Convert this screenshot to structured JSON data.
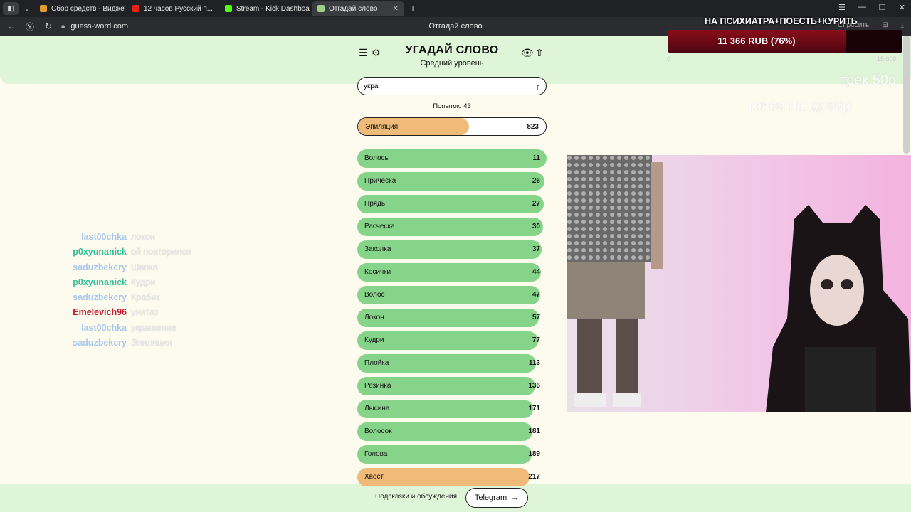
{
  "browser": {
    "tabs": [
      {
        "title": "Сбор средств - Виджеты",
        "color": "#e39a2e",
        "active": false
      },
      {
        "title": "12 часов Русский п...",
        "color": "#e62117",
        "active": false
      },
      {
        "title": "Stream - Kick Dashboard",
        "color": "#53fc18",
        "active": false
      },
      {
        "title": "Отгадай слово",
        "color": "#9bd08a",
        "active": true
      }
    ],
    "url": "guess-word.com",
    "page_title": "Отгадай слово",
    "right_label": "Спросить"
  },
  "game": {
    "title": "УГАДАЙ СЛОВО",
    "level": "Средний уровень",
    "input_value": "укра",
    "attempts": "Попыток: 43",
    "last_guess": {
      "word": "Эпиляция",
      "rank": "823",
      "fill": 0.59,
      "color": "#f0bb79"
    },
    "guesses": [
      {
        "word": "Волосы",
        "rank": "11",
        "fill": 1.0,
        "color": "#86d48a"
      },
      {
        "word": "Прическа",
        "rank": "26",
        "fill": 0.99,
        "color": "#86d48a"
      },
      {
        "word": "Прядь",
        "rank": "27",
        "fill": 0.985,
        "color": "#86d48a"
      },
      {
        "word": "Расческа",
        "rank": "30",
        "fill": 0.98,
        "color": "#86d48a"
      },
      {
        "word": "Заколка",
        "rank": "37",
        "fill": 0.975,
        "color": "#86d48a"
      },
      {
        "word": "Косички",
        "rank": "44",
        "fill": 0.97,
        "color": "#86d48a"
      },
      {
        "word": "Волос",
        "rank": "47",
        "fill": 0.965,
        "color": "#86d48a"
      },
      {
        "word": "Локон",
        "rank": "57",
        "fill": 0.96,
        "color": "#86d48a"
      },
      {
        "word": "Кудри",
        "rank": "77",
        "fill": 0.955,
        "color": "#86d48a"
      },
      {
        "word": "Плойка",
        "rank": "113",
        "fill": 0.945,
        "color": "#86d48a"
      },
      {
        "word": "Резинка",
        "rank": "136",
        "fill": 0.94,
        "color": "#86d48a"
      },
      {
        "word": "Лысина",
        "rank": "171",
        "fill": 0.93,
        "color": "#86d48a"
      },
      {
        "word": "Волосок",
        "rank": "181",
        "fill": 0.925,
        "color": "#86d48a"
      },
      {
        "word": "Голова",
        "rank": "189",
        "fill": 0.92,
        "color": "#86d48a"
      },
      {
        "word": "Хвост",
        "rank": "217",
        "fill": 0.91,
        "color": "#f0bb79"
      }
    ],
    "footer_text": "Подсказки и обсуждения",
    "telegram_label": "Telegram"
  },
  "stream": {
    "donation": {
      "title": "НА ПСИХИАТРА+ПОЕСТЬ+КУРИТЬ",
      "amount": "11 366 RUB (76%)",
      "progress": 0.76,
      "min": "0",
      "max": "15 000"
    },
    "ghost_text": [
      "трек 50р",
      "голос на кд 50р"
    ],
    "chat": [
      {
        "user": "last00chka",
        "msg": "локон",
        "color": "#a9c8ee"
      },
      {
        "user": "p0xyunanick",
        "msg": "ой повторился",
        "color": "#2fbf9a"
      },
      {
        "user": "saduzbekcry",
        "msg": "Шапка",
        "color": "#a9c8ee"
      },
      {
        "user": "p0xyunanick",
        "msg": "Кудри",
        "color": "#2fbf9a"
      },
      {
        "user": "saduzbekcry",
        "msg": "Крабик",
        "color": "#a9c8ee"
      },
      {
        "user": "Emelevich96",
        "msg": "унитаз",
        "color": "#c4182e"
      },
      {
        "user": "last00chka",
        "msg": "украшение",
        "color": "#a9c8ee"
      },
      {
        "user": "saduzbekcry",
        "msg": "Эпиляция",
        "color": "#a9c8ee"
      }
    ]
  }
}
